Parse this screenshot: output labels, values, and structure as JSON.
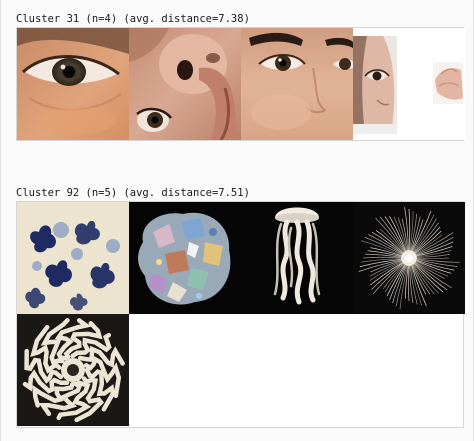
{
  "clusters": [
    {
      "header": "Cluster 31 (n=4) (avg. distance=7.38)",
      "images": [
        "eye-closeup-photo",
        "nose-mouth-closeup-photo",
        "face-eyes-closeup-photo",
        "sleeping-face-with-hand-photo"
      ]
    },
    {
      "header": "Cluster 92 (n=5) (avg. distance=7.51)",
      "images": [
        "blue-ink-blots-image",
        "iridescent-crystal-rock-image",
        "jellyfish-image",
        "radial-fiber-burst-image",
        "spiral-coral-pattern-image"
      ]
    }
  ],
  "colors": {
    "background": "#fafafa",
    "grid_border": "#d6d6d6",
    "text": "#1a1a1a"
  }
}
